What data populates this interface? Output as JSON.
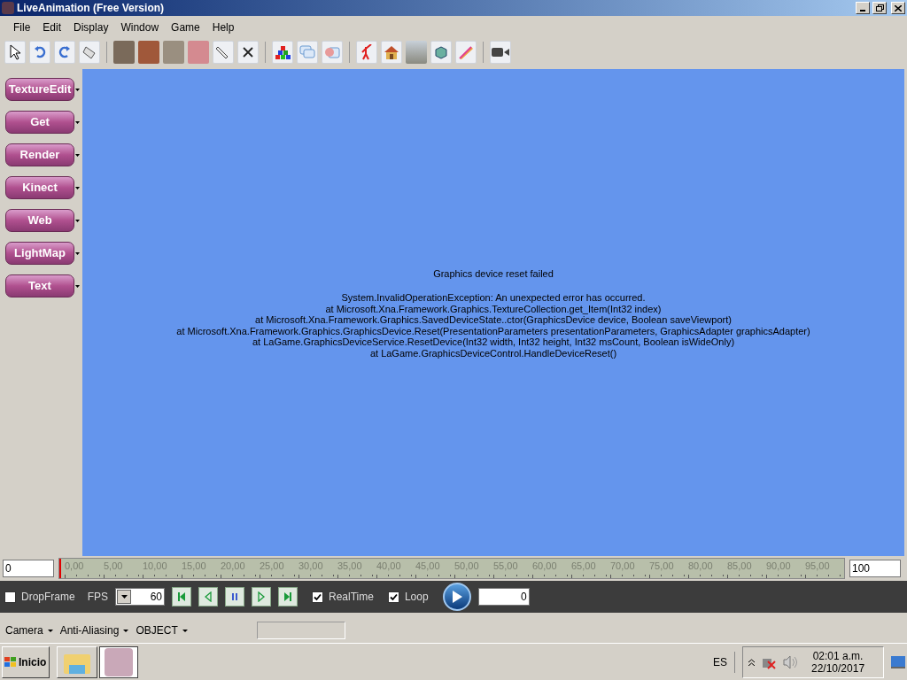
{
  "window": {
    "title": "LiveAnimation (Free Version)"
  },
  "menu": [
    "File",
    "Edit",
    "Display",
    "Window",
    "Game",
    "Help"
  ],
  "sidebar": {
    "buttons": [
      "TextureEdit",
      "Get",
      "Render",
      "Kinect",
      "Web",
      "LightMap",
      "Text"
    ]
  },
  "viewport": {
    "error_title": "Graphics device reset failed",
    "error_lines": [
      "System.InvalidOperationException: An unexpected error has occurred.",
      "at Microsoft.Xna.Framework.Graphics.TextureCollection.get_Item(Int32 index)",
      "at Microsoft.Xna.Framework.Graphics.SavedDeviceState..ctor(GraphicsDevice device, Boolean saveViewport)",
      "at Microsoft.Xna.Framework.Graphics.GraphicsDevice.Reset(PresentationParameters presentationParameters, GraphicsAdapter graphicsAdapter)",
      "at LaGame.GraphicsDeviceService.ResetDevice(Int32 width, Int32 height, Int32 msCount, Boolean isWideOnly)",
      "at LaGame.GraphicsDeviceControl.HandleDeviceReset()"
    ]
  },
  "timeline": {
    "start": "0",
    "end": "100",
    "level": 0,
    "ticks": [
      "0,00",
      "5,00",
      "10,00",
      "15,00",
      "20,00",
      "25,00",
      "30,00",
      "35,00",
      "40,00",
      "45,00",
      "50,00",
      "55,00",
      "60,00",
      "65,00",
      "70,00",
      "75,00",
      "80,00",
      "85,00",
      "90,00",
      "95,00"
    ]
  },
  "controls": {
    "dropframe": {
      "label": "DropFrame",
      "checked": false
    },
    "fps_label": "FPS",
    "fps": "60",
    "realtime": {
      "label": "RealTime",
      "checked": true
    },
    "loop": {
      "label": "Loop",
      "checked": true
    },
    "frame": "0"
  },
  "status_bar": {
    "menus": [
      "Camera",
      "Anti-Aliasing",
      "OBJECT"
    ]
  },
  "taskbar": {
    "start": "Inicio",
    "language": "ES",
    "time": "02:01 a.m.",
    "date": "22/10/2017"
  }
}
